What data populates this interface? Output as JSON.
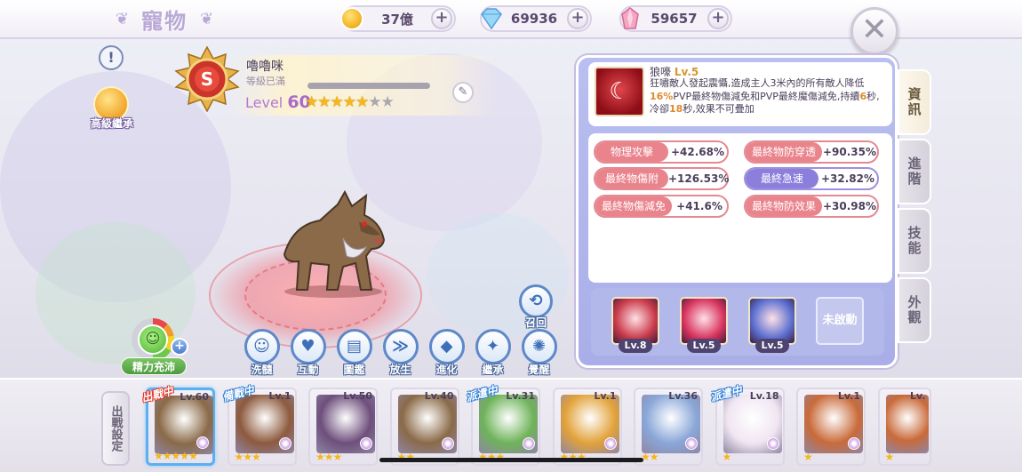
{
  "header": {
    "title": "寵物",
    "currencies": [
      {
        "name": "coin",
        "icon": "gold-coin-icon",
        "value": "37億",
        "color": "#f3b322"
      },
      {
        "name": "diamond",
        "icon": "diamond-icon",
        "value": "69936",
        "color": "#7fc4f2"
      },
      {
        "name": "crystal",
        "icon": "crystal-icon",
        "value": "59657",
        "color": "#f08ab0"
      }
    ],
    "close_icon": "✕"
  },
  "pet": {
    "rank": "S",
    "name": "嚕嚕咪",
    "sub": "等級已滿",
    "level_prefix": "Level ",
    "level": "60",
    "stars_filled": 5,
    "stars_total": 7,
    "inherit_label": "高級繼承",
    "info_icon": "!"
  },
  "stage": {
    "recall_label": "召回",
    "stamina_label": "精力充沛",
    "actions": [
      {
        "label": "洗髓",
        "icon": "face-wash-icon",
        "glyph": "☺"
      },
      {
        "label": "互動",
        "icon": "heart-icon",
        "glyph": "♥"
      },
      {
        "label": "圖鑑",
        "icon": "book-icon",
        "glyph": "▤"
      },
      {
        "label": "放生",
        "icon": "fish-icon",
        "glyph": "≫"
      },
      {
        "label": "進化",
        "icon": "crystal-evolve-icon",
        "glyph": "◆"
      },
      {
        "label": "繼承",
        "icon": "candy-icon",
        "glyph": "✦"
      },
      {
        "label": "覺醒",
        "icon": "awaken-icon",
        "glyph": "✺"
      }
    ]
  },
  "skill": {
    "name": "狼嚎",
    "level": "Lv.5",
    "desc_parts": [
      {
        "t": "狂嘯敵人發起震懾,造成主人3米內的所有敵人降低",
        "hl": false
      },
      {
        "t": "16%",
        "hl": true
      },
      {
        "t": "PVP最終物傷減免和PVP最終魔傷減免,持續",
        "hl": false
      },
      {
        "t": "6",
        "hl": true
      },
      {
        "t": "秒,冷卻",
        "hl": false
      },
      {
        "t": "18",
        "hl": true
      },
      {
        "t": "秒,效果不可疊加",
        "hl": false
      }
    ]
  },
  "stats": [
    {
      "name": "物理攻擊",
      "value": "+42.68%",
      "style": "red"
    },
    {
      "name": "最終物防穿透",
      "value": "+90.35%",
      "style": "red"
    },
    {
      "name": "最終物傷附加",
      "value": "+126.53%",
      "style": "red"
    },
    {
      "name": "最終急速",
      "value": "+32.82%",
      "style": "purple"
    },
    {
      "name": "最終物傷減免",
      "value": "+41.6%",
      "style": "red"
    },
    {
      "name": "最終物防效果",
      "value": "+30.98%",
      "style": "red"
    }
  ],
  "skill_slots": [
    {
      "level": "Lv.8",
      "icon": "slash-skill-icon",
      "color": "#c93a4a"
    },
    {
      "level": "Lv.5",
      "icon": "fire-orb-skill-icon",
      "color": "#d8345f"
    },
    {
      "level": "Lv.5",
      "icon": "sword-skill-icon",
      "color": "#5b6fd0"
    }
  ],
  "skill_slot_empty": "未啟動",
  "side_tabs": [
    "資訊",
    "進階",
    "技能",
    "外觀"
  ],
  "roster": {
    "deploy_label": "出戰設定",
    "pets": [
      {
        "level": "Lv.60",
        "tag": "出戰中",
        "tag_color": "red",
        "stars": 5,
        "color": "#8a6a48",
        "selected": true
      },
      {
        "level": "Lv.1",
        "tag": "備戰中",
        "tag_color": "blue",
        "stars": 3,
        "color": "#8d5a3d",
        "selected": false
      },
      {
        "level": "Lv.50",
        "tag": "",
        "tag_color": "",
        "stars": 3,
        "color": "#6e4f7c",
        "selected": false
      },
      {
        "level": "Lv.40",
        "tag": "",
        "tag_color": "",
        "stars": 2,
        "color": "#8a6a48",
        "selected": false
      },
      {
        "level": "Lv.31",
        "tag": "派遣中",
        "tag_color": "blue",
        "stars": 3,
        "color": "#6fb35a",
        "selected": false
      },
      {
        "level": "Lv.1",
        "tag": "",
        "tag_color": "",
        "stars": 3,
        "color": "#e2a23a",
        "selected": false
      },
      {
        "level": "Lv.36",
        "tag": "",
        "tag_color": "",
        "stars": 2,
        "color": "#8aa7d8",
        "selected": false
      },
      {
        "level": "Lv.18",
        "tag": "派遣中",
        "tag_color": "blue",
        "stars": 1,
        "color": "#f0e6f2",
        "selected": false
      },
      {
        "level": "Lv.1",
        "tag": "",
        "tag_color": "",
        "stars": 1,
        "color": "#c96a3a",
        "selected": false
      },
      {
        "level": "Lv.",
        "tag": "",
        "tag_color": "",
        "stars": 1,
        "color": "#c96a3a",
        "selected": false
      }
    ]
  }
}
